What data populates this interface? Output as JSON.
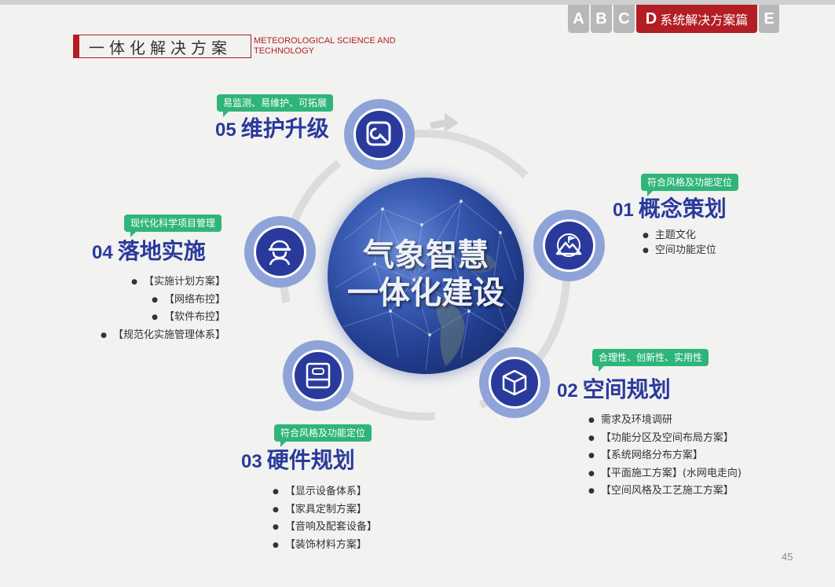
{
  "tabs": [
    {
      "letter": "A",
      "label": ""
    },
    {
      "letter": "B",
      "label": ""
    },
    {
      "letter": "C",
      "label": ""
    },
    {
      "letter": "D",
      "label": "系统解决方案篇"
    },
    {
      "letter": "E",
      "label": ""
    }
  ],
  "header": {
    "title": "一体化解决方案",
    "subtitle_en": "METEOROLOGICAL SCIENCE AND TECHNOLOGY"
  },
  "center": {
    "line1": "气象智慧",
    "line2": "一体化建设"
  },
  "steps": [
    {
      "num": "01",
      "title": "概念策划",
      "tag": "符合风格及功能定位",
      "icon": "mountain-flag-icon",
      "items": [
        "主题文化",
        "空间功能定位"
      ]
    },
    {
      "num": "02",
      "title": "空间规划",
      "tag": "合理性、创新性、实用性",
      "icon": "cube-icon",
      "items": [
        "需求及环境调研",
        "【功能分区及空间布局方案】",
        "【系统网络分布方案】",
        "【平面施工方案】(水网电走向)",
        "【空间风格及工艺施工方案】"
      ]
    },
    {
      "num": "03",
      "title": "硬件规划",
      "tag": "符合风格及功能定位",
      "icon": "hardware-drive-icon",
      "items": [
        "【显示设备体系】",
        "【家具定制方案】",
        "【音响及配套设备】",
        "【装饰材料方案】"
      ]
    },
    {
      "num": "04",
      "title": "落地实施",
      "tag": "现代化科学项目管理",
      "icon": "worker-helmet-icon",
      "items": [
        "【实施计划方案】",
        "【网络布控】",
        "【软件布控】",
        "【规范化实施管理体系】"
      ]
    },
    {
      "num": "05",
      "title": "维护升级",
      "tag": "易监测、易维护、可拓展",
      "icon": "wrench-maintenance-icon",
      "items": []
    }
  ],
  "page_number": "45",
  "colors": {
    "brand_red": "#b21e24",
    "node_blue": "#2a3a9c",
    "tag_green": "#2fb57a"
  }
}
